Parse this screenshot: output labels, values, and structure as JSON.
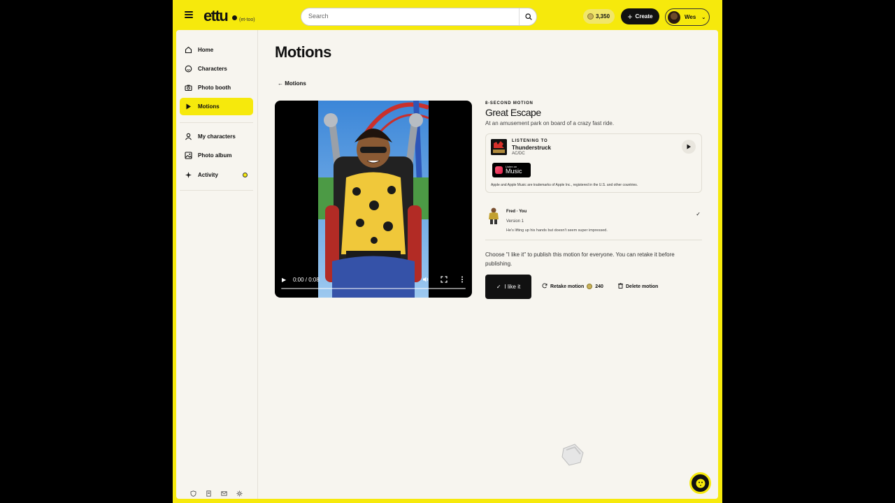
{
  "header": {
    "logo": "ettu",
    "logo_sub": "(et-too)",
    "search_placeholder": "Search",
    "coins": "3,350",
    "create_label": "Create",
    "user_name": "Wes"
  },
  "sidebar": {
    "items": [
      {
        "label": "Home",
        "icon": "home-icon"
      },
      {
        "label": "Characters",
        "icon": "smiley-icon"
      },
      {
        "label": "Photo booth",
        "icon": "camera-icon"
      },
      {
        "label": "Motions",
        "icon": "play-icon",
        "active": true
      },
      {
        "label": "My characters",
        "icon": "person-icon"
      },
      {
        "label": "Photo album",
        "icon": "image-icon"
      },
      {
        "label": "Activity",
        "icon": "sparkle-icon"
      }
    ],
    "footer_icons": [
      "shield-icon",
      "document-icon",
      "mail-icon",
      "settings-icon"
    ]
  },
  "main": {
    "page_title": "Motions",
    "back_link": "← Motions",
    "video": {
      "time": "0:00 / 0:08",
      "progress": 0
    },
    "motion": {
      "eyebrow": "8-SECOND MOTION",
      "title": "Great Escape",
      "description": "At an amusement park on board of a crazy fast ride."
    },
    "music": {
      "listening_label": "LISTENING TO",
      "track": "Thunderstruck",
      "artist": "AC/DC",
      "badge_small": "Listen on",
      "badge_big": "Music",
      "trademark": "Apple and Apple Music are trademarks of Apple Inc., registered in the U.S. and other countries."
    },
    "version": {
      "name": "Fred · You",
      "version": "Version 1",
      "note": "He's lifting up his hands but doesn't seem super impressed."
    },
    "choose_text": "Choose \"I like it\" to publish this motion for everyone. You can retake it before publishing.",
    "actions": {
      "like": "I like it",
      "retake": "Retake motion",
      "retake_cost": "240",
      "delete": "Delete motion"
    }
  },
  "colors": {
    "brand": "#f6e90c",
    "background": "#f7f5ef",
    "primary": "#111111"
  }
}
